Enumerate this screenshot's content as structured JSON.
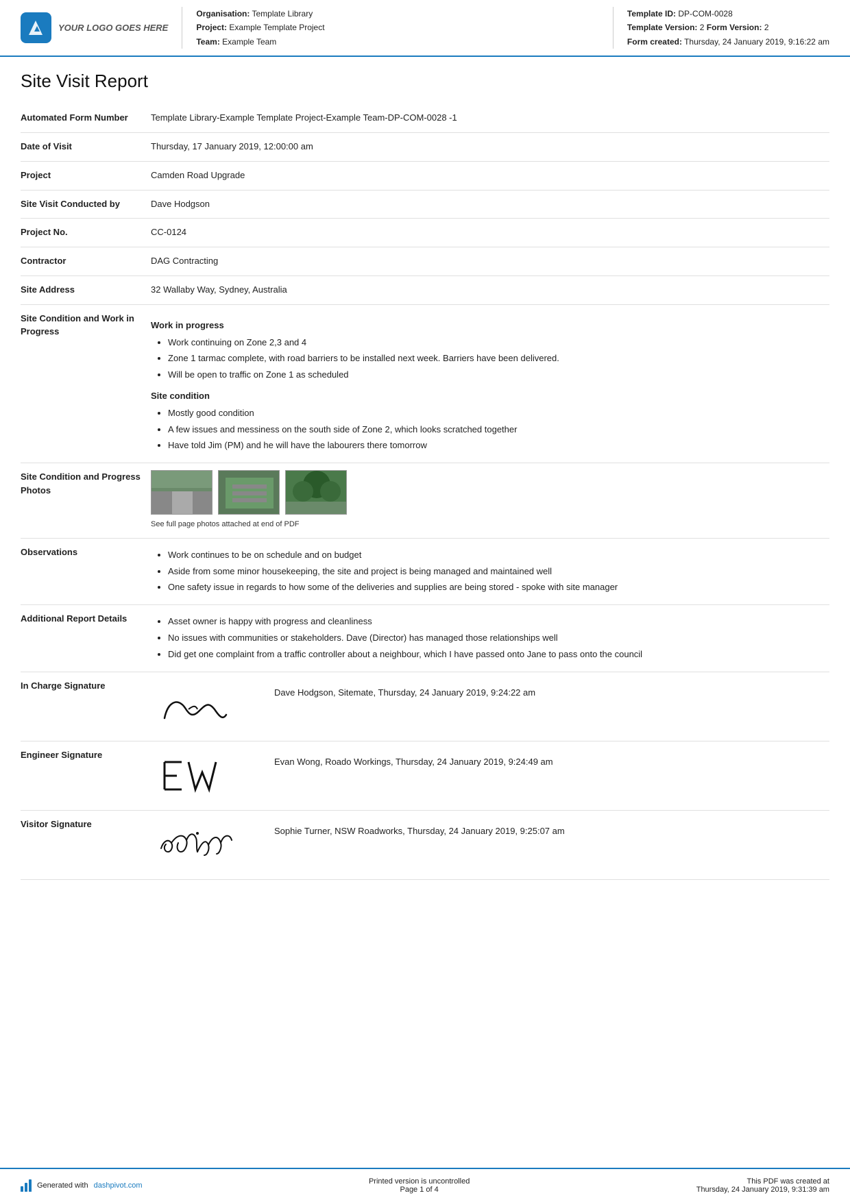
{
  "header": {
    "logo_text": "YOUR LOGO GOES HERE",
    "org_label": "Organisation:",
    "org_value": "Template Library",
    "project_label": "Project:",
    "project_value": "Example Template Project",
    "team_label": "Team:",
    "team_value": "Example Team",
    "template_id_label": "Template ID:",
    "template_id_value": "DP-COM-0028",
    "template_version_label": "Template Version:",
    "template_version_value": "2",
    "form_version_label": "Form Version:",
    "form_version_value": "2",
    "form_created_label": "Form created:",
    "form_created_value": "Thursday, 24 January 2019, 9:16:22 am"
  },
  "report": {
    "title": "Site Visit Report",
    "fields": {
      "automated_form_number_label": "Automated Form Number",
      "automated_form_number_value": "Template Library-Example Template Project-Example Team-DP-COM-0028   -1",
      "date_of_visit_label": "Date of Visit",
      "date_of_visit_value": "Thursday, 17 January 2019, 12:00:00 am",
      "project_label": "Project",
      "project_value": "Camden Road Upgrade",
      "site_visit_conducted_label": "Site Visit Conducted by",
      "site_visit_conducted_value": "Dave Hodgson",
      "project_no_label": "Project No.",
      "project_no_value": "CC-0124",
      "contractor_label": "Contractor",
      "contractor_value": "DAG Contracting",
      "site_address_label": "Site Address",
      "site_address_value": "32 Wallaby Way, Sydney, Australia",
      "site_condition_label": "Site Condition and Work in Progress",
      "site_condition_work_title": "Work in progress",
      "work_bullets": [
        "Work continuing on Zone 2,3 and 4",
        "Zone 1 tarmac complete, with road barriers to be installed next week. Barriers have been delivered.",
        "Will be open to traffic on Zone 1 as scheduled"
      ],
      "site_condition_title": "Site condition",
      "site_bullets": [
        "Mostly good condition",
        "A few issues and messiness on the south side of Zone 2, which looks scratched together",
        "Have told Jim (PM) and he will have the labourers there tomorrow"
      ],
      "photos_label": "Site Condition and Progress Photos",
      "photos_caption": "See full page photos attached at end of PDF",
      "observations_label": "Observations",
      "observations_bullets": [
        "Work continues to be on schedule and on budget",
        "Aside from some minor housekeeping, the site and project is being managed and maintained well",
        "One safety issue in regards to how some of the deliveries and supplies are being stored - spoke with site manager"
      ],
      "additional_label": "Additional Report Details",
      "additional_bullets": [
        "Asset owner is happy with progress and cleanliness",
        "No issues with communities or stakeholders. Dave (Director) has managed those relationships well",
        "Did get one complaint from a traffic controller about a neighbour, which I have passed onto Jane to pass onto the council"
      ],
      "in_charge_label": "In Charge Signature",
      "in_charge_sig_text": "Dave Hodgson, Sitemate, Thursday, 24 January 2019, 9:24:22 am",
      "engineer_label": "Engineer Signature",
      "engineer_sig_text": "Evan Wong, Roado Workings, Thursday, 24 January 2019, 9:24:49 am",
      "visitor_label": "Visitor Signature",
      "visitor_sig_text": "Sophie Turner, NSW Roadworks, Thursday, 24 January 2019, 9:25:07 am"
    }
  },
  "footer": {
    "generated_prefix": "Generated with ",
    "generated_link": "dashpivot.com",
    "uncontrolled_text": "Printed version is uncontrolled",
    "page_label": "Page 1 of 4",
    "pdf_created_label": "This PDF was created at",
    "pdf_created_value": "Thursday, 24 January 2019, 9:31:39 am"
  }
}
